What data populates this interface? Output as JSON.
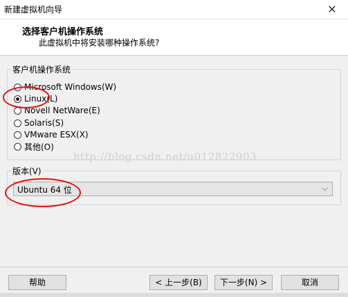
{
  "window": {
    "title": "新建虚拟机向导",
    "close_glyph": "✕"
  },
  "header": {
    "title": "选择客户机操作系统",
    "subtitle": "此虚拟机中将安装哪种操作系统?"
  },
  "os_group": {
    "label": "客户机操作系统",
    "options": [
      {
        "label": "Microsoft Windows(W)",
        "checked": false
      },
      {
        "label": "Linux(L)",
        "checked": true
      },
      {
        "label": "Novell NetWare(E)",
        "checked": false
      },
      {
        "label": "Solaris(S)",
        "checked": false
      },
      {
        "label": "VMware ESX(X)",
        "checked": false
      },
      {
        "label": "其他(O)",
        "checked": false
      }
    ]
  },
  "version_group": {
    "label": "版本(V)",
    "selected": "Ubuntu 64 位"
  },
  "watermark": "http://blog.csdn.net/u012822903",
  "buttons": {
    "help": "帮助",
    "back": "< 上一步(B)",
    "next": "下一步(N) >",
    "cancel": "取消"
  },
  "colors": {
    "highlight_circle": "#e01010",
    "dialog_bg": "#f0f0f0",
    "header_bg": "#ffffff"
  }
}
